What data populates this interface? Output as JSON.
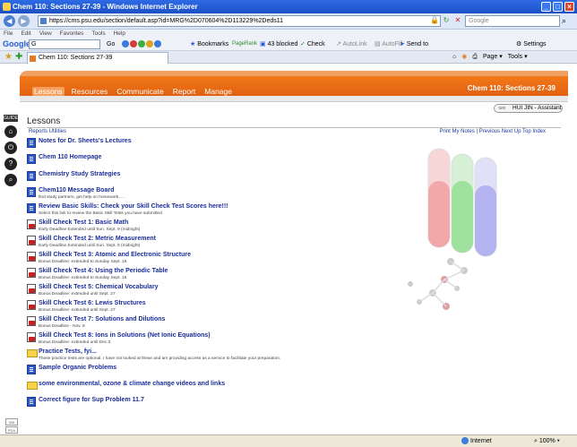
{
  "window": {
    "title": "Chem 110: Sections 27-39 - Windows Internet Explorer"
  },
  "address": {
    "url": "https://cms.psu.edu/section/default.asp?id=MRG%2D070604%2D113229%2Deds11",
    "search_placeholder": "Google"
  },
  "menu": [
    "File",
    "Edit",
    "View",
    "Favorites",
    "Tools",
    "Help"
  ],
  "googlebar": {
    "logo": "Google",
    "search_value": "G",
    "go": "Go",
    "bookmarks": "Bookmarks",
    "pagerank": "PageRank",
    "blocked": "43 blocked",
    "check": "Check",
    "autolink": "AutoLink",
    "autofill": "AutoFill",
    "sendto": "Send to",
    "settings": "Settings"
  },
  "tab": {
    "label": "Chem 110: Sections 27-39"
  },
  "cmdbar": {
    "page": "Page",
    "tools": "Tools"
  },
  "course": {
    "title": "Chem 110: Sections 27-39",
    "nav": [
      "Lessons",
      "Resources",
      "Communicate",
      "Report",
      "Manage"
    ],
    "user": "HUI JIN - Assistant"
  },
  "sidebar": {
    "guide": "GUIDE"
  },
  "lessons": {
    "title": "Lessons",
    "sublinks": "Reports  Utilities",
    "rightlinks": "Print My Notes | Previous  Next  Up  Top  Index",
    "items": [
      {
        "icon": "doc",
        "title": "Notes for Dr. Sheets's Lectures",
        "desc": ""
      },
      {
        "icon": "doc",
        "title": "Chem 110 Homepage",
        "desc": ""
      },
      {
        "icon": "doc",
        "title": "Chemistry Study Strategies",
        "desc": ""
      },
      {
        "icon": "doc",
        "title": "Chem110 Message Board",
        "desc": "find study partners, get help on homework, ..."
      },
      {
        "icon": "doc",
        "title": "Review Basic Skills: Check your Skill Check Test Scores here!!!",
        "desc": "Select this link to review the Basic Skill Tests you have submitted"
      },
      {
        "icon": "test",
        "title": "Skill Check Test 1: Basic Math",
        "desc": "Early Deadline Extended until Sun. Sept. 9 (midnight)"
      },
      {
        "icon": "test",
        "title": "Skill Check Test 2: Metric Measurement",
        "desc": "Early Deadline Extended until Sun. Sept. 9 (midnight)"
      },
      {
        "icon": "test",
        "title": "Skill Check Test 3: Atomic and Electronic Structure",
        "desc": "Bonus Deadline: extended to Sunday Sept. 16"
      },
      {
        "icon": "test",
        "title": "Skill Check Test 4: Using the Periodic Table",
        "desc": "Bonus Deadline: extended to Sunday Sept. 16"
      },
      {
        "icon": "test",
        "title": "Skill Check Test 5: Chemical Vocabulary",
        "desc": "Bonus Deadline: extended until Sept. 27"
      },
      {
        "icon": "test",
        "title": "Skill Check Test 6: Lewis Structures",
        "desc": "Bonus Deadline: extended until Sept. 27"
      },
      {
        "icon": "test",
        "title": "Skill Check Test 7: Solutions and Dilutions",
        "desc": "Bonus Deadline - Nov. 8"
      },
      {
        "icon": "test",
        "title": "Skill Check Test 8: Ions in Solutions (Net Ionic Equations)",
        "desc": "Bonus Deadline: extended until Dec 3"
      },
      {
        "icon": "folder",
        "title": "Practice Tests, fyi...",
        "desc": "These practice tests are optional. I have not looked at these and am providing access as a service to facilitate your preparation."
      },
      {
        "icon": "doc",
        "title": "Sample Organic Problems",
        "desc": ""
      },
      {
        "icon": "folder",
        "title": "some environmental, ozone & climate change videos and links",
        "desc": ""
      },
      {
        "icon": "doc",
        "title": "Correct figure for Sup Problem 11.7",
        "desc": ""
      }
    ]
  },
  "leftmarks": [
    "508",
    "PDA"
  ],
  "status": {
    "zone": "Internet",
    "zoom": "100%"
  }
}
